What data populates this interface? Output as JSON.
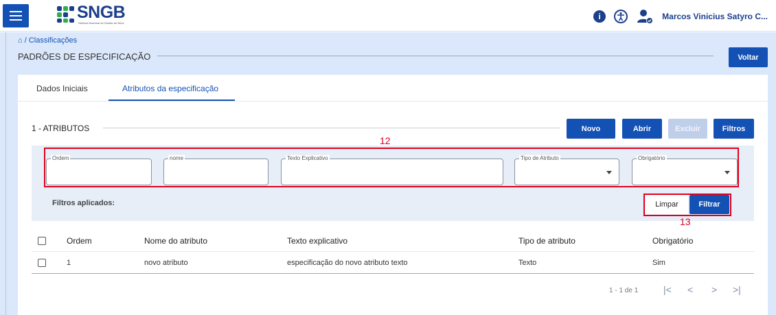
{
  "topbar": {
    "logo_text": "SNGB",
    "logo_subtitle": "Sistema Nacional de Gestão de Bens",
    "user_name": "Marcos Vinicius Satyro C...",
    "icons": [
      "menu-icon",
      "info-icon",
      "accessibility-icon",
      "user-account-icon"
    ]
  },
  "header": {
    "breadcrumb": "/ Classificações",
    "title": "PADRÕES DE ESPECIFICAÇÃO",
    "back_button": "Voltar"
  },
  "tabs": [
    {
      "label": "Dados Iniciais",
      "active": false
    },
    {
      "label": "Atributos da especificação",
      "active": true
    }
  ],
  "section": {
    "title": "1 - ATRIBUTOS",
    "buttons": {
      "new": "Novo",
      "open": "Abrir",
      "delete": "Excluir",
      "filters": "Filtros"
    }
  },
  "filters": {
    "fields": [
      {
        "label": "Ordem",
        "value": ""
      },
      {
        "label": "nome",
        "value": ""
      },
      {
        "label": "Texto Explicativo",
        "value": ""
      },
      {
        "label": "Tipo de Atributo",
        "value": ""
      },
      {
        "label": "Obrigatório",
        "value": ""
      }
    ],
    "applied_label": "Filtros aplicados:",
    "clear_button": "Limpar",
    "filter_button": "Filtrar"
  },
  "annotations": {
    "filters_box": "12",
    "buttons_box": "13"
  },
  "table": {
    "headers": [
      "Ordem",
      "Nome do atributo",
      "Texto explicativo",
      "Tipo de atributo",
      "Obrigatório"
    ],
    "rows": [
      {
        "ordem": "1",
        "nome": "novo atributo",
        "texto": "especificação do novo atributo texto",
        "tipo": "Texto",
        "obrigatorio": "Sim"
      }
    ]
  },
  "pagination": {
    "range": "1 - 1 de 1"
  },
  "colors": {
    "primary": "#1351b4",
    "header_bg": "#dbe8fb",
    "annotation": "#e0001b"
  }
}
